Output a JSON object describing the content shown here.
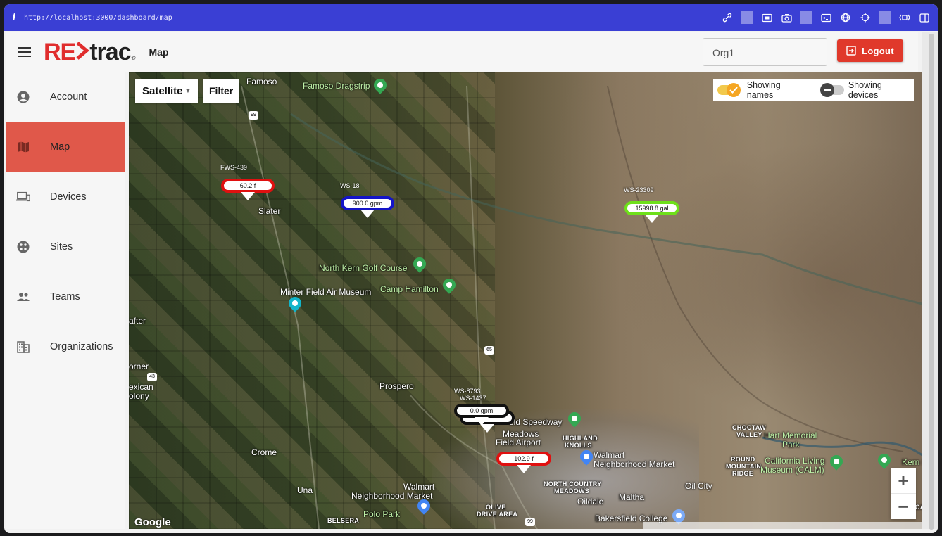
{
  "browser": {
    "url": "http://localhost:3000/dashboard/map"
  },
  "app": {
    "brand_left": "RE",
    "brand_right": "trac",
    "brand_mark": "®",
    "page_title": "Map",
    "org_value": "Org1",
    "logout_label": "Logout"
  },
  "sidebar": {
    "items": [
      {
        "label": "Account",
        "icon": "account-circle-icon",
        "active": false
      },
      {
        "label": "Map",
        "icon": "map-icon",
        "active": true
      },
      {
        "label": "Devices",
        "icon": "devices-icon",
        "active": false
      },
      {
        "label": "Sites",
        "icon": "sites-icon",
        "active": false
      },
      {
        "label": "Teams",
        "icon": "people-icon",
        "active": false
      },
      {
        "label": "Organizations",
        "icon": "building-icon",
        "active": false
      }
    ]
  },
  "map": {
    "type_label": "Satellite",
    "filter_label": "Filter",
    "toggle_names_label": "Showing names",
    "toggle_devices_label": "Showing devices",
    "names_on": true,
    "devices_on": false,
    "zoom_in": "+",
    "zoom_out": "−",
    "google_label": "Google",
    "places": {
      "famoso": "Famoso",
      "famoso_dragstrip": "Famoso Dragstrip",
      "slater": "Slater",
      "north_kern_golf": "North Kern Golf Course",
      "minter_field": "Minter Field Air Museum",
      "camp_hamilton": "Camp Hamilton",
      "after": "after",
      "orner": "orner",
      "mexican_colony_1": "exican",
      "mexican_colony_2": "olony",
      "prospero": "Prospero",
      "crome": "Crome",
      "una": "Una",
      "walmart_1a": "Walmart",
      "walmart_1b": "Neighborhood Market",
      "polo_park": "Polo Park",
      "belsera": "BELSERA",
      "olive_drive_1": "OLIVE",
      "olive_drive_2": "DRIVE AREA",
      "speedway": "eld Speedway",
      "meadows": "Meadows",
      "airport": "Field Airport",
      "highland_knolls_1": "HIGHLAND",
      "highland_knolls_2": "KNOLLS",
      "walmart_2a": "Walmart",
      "walmart_2b": "Neighborhood Market",
      "north_country_1": "NORTH COUNTRY",
      "north_country_2": "MEADOWS",
      "oildale": "Oildale",
      "maltha": "Maltha",
      "oil_city": "Oil City",
      "bakersfield_college": "Bakersfield College",
      "choctaw_1": "CHOCTAW",
      "choctaw_2": "VALLEY",
      "hart_park_1": "Hart Memorial",
      "hart_park_2": "Park",
      "round_mountain_1": "ROUND",
      "round_mountain_2": "MOUNTAIN",
      "round_mountain_3": "RIDGE",
      "calm_1": "California Living",
      "calm_2": "Museum (CALM)",
      "kern_river": "Kern Riv",
      "tusc": "TUSCA"
    },
    "roads": [
      "99",
      "65",
      "43",
      "99"
    ],
    "markers": [
      {
        "name": "FWS-439",
        "value": "60.2 f",
        "color": "#e01010"
      },
      {
        "name": "WS-18",
        "value": "900.0 gpm",
        "color": "#1414c8"
      },
      {
        "name": "WS-23309",
        "value": "15998.8 gal",
        "color": "#6ee01a"
      },
      {
        "name": "WS-8793",
        "value": "0.0 gpm",
        "color": "#111111"
      },
      {
        "name": "WS-1437",
        "value": "",
        "color": "#111111"
      },
      {
        "name": "",
        "value": "102.9 f",
        "color": "#e01010"
      }
    ]
  }
}
